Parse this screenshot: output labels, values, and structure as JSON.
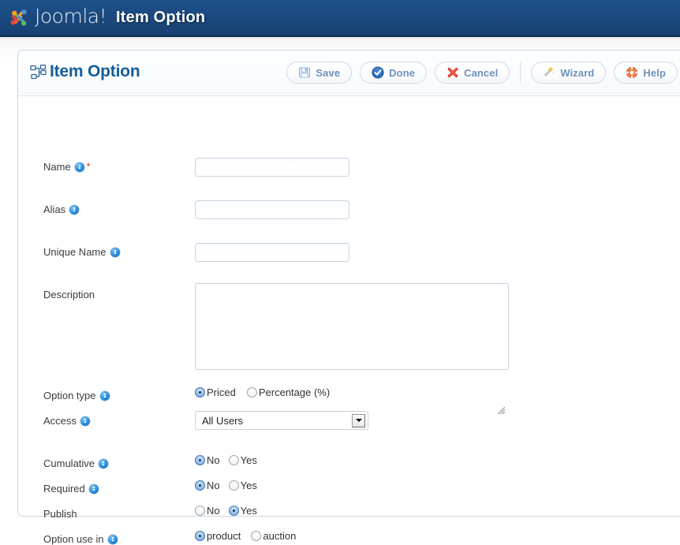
{
  "topbar": {
    "brand": "Joomla!",
    "brand_icon": "joomla-logo-icon",
    "title": "Item Option"
  },
  "panel": {
    "icon": "item-option-node-tree-icon",
    "title": "Item Option"
  },
  "toolbar": {
    "buttons": [
      {
        "label": "Save",
        "icon": "floppy-disk-icon"
      },
      {
        "label": "Done",
        "icon": "check-circle-icon"
      },
      {
        "label": "Cancel",
        "icon": "red-x-icon"
      },
      {
        "label": "Wizard",
        "icon": "magic-wand-icon"
      },
      {
        "label": "Help",
        "icon": "lifebuoy-icon"
      }
    ],
    "separator_after_index": 2
  },
  "form": {
    "name": {
      "label": "Name",
      "required_marker": "*",
      "info_icon": "info-icon",
      "value": "",
      "placeholder": ""
    },
    "alias": {
      "label": "Alias",
      "info_icon": "info-icon",
      "value": "",
      "placeholder": ""
    },
    "unique_name": {
      "label": "Unique Name",
      "info_icon": "info-icon",
      "value": "",
      "placeholder": ""
    },
    "description": {
      "label": "Description",
      "value": "",
      "placeholder": ""
    },
    "option_type": {
      "label": "Option type",
      "info_icon": "info-icon",
      "options": [
        {
          "label": "Priced",
          "selected": true
        },
        {
          "label": "Percentage (%)",
          "selected": false
        }
      ]
    },
    "access": {
      "label": "Access",
      "info_icon": "info-icon",
      "selected": "All Users",
      "dropdown_icon": "chevron-down-icon"
    },
    "cumulative": {
      "label": "Cumulative",
      "info_icon": "info-icon",
      "options": [
        {
          "label": "No",
          "selected": true
        },
        {
          "label": "Yes",
          "selected": false
        }
      ]
    },
    "required": {
      "label": "Required",
      "info_icon": "info-icon",
      "options": [
        {
          "label": "No",
          "selected": true
        },
        {
          "label": "Yes",
          "selected": false
        }
      ]
    },
    "publish": {
      "label": "Publish",
      "options": [
        {
          "label": "No",
          "selected": false
        },
        {
          "label": "Yes",
          "selected": true
        }
      ]
    },
    "option_use_in": {
      "label": "Option use in",
      "info_icon": "info-icon",
      "options": [
        {
          "label": "product",
          "selected": true
        },
        {
          "label": "auction",
          "selected": false
        }
      ]
    }
  },
  "colors": {
    "header_blue": "#1d4f89",
    "panel_title_blue": "#145d99",
    "toolbar_label_blue": "#6f91bd",
    "required_red": "#dd2222",
    "info_icon_blue": "#2a8fe0"
  }
}
